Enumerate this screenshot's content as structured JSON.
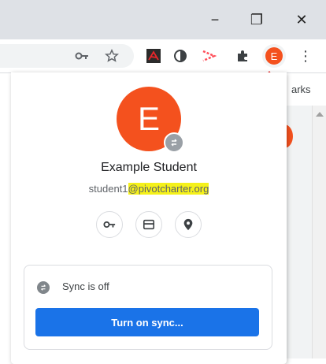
{
  "window": {
    "minimize_glyph": "−",
    "restore_glyph": "❐",
    "close_glyph": "✕"
  },
  "toolbar": {
    "icons": [
      "key-icon",
      "star-icon",
      "acrobat-icon",
      "circle-half-icon",
      "screencastify-icon",
      "extensions-icon"
    ],
    "profile_initial": "E",
    "menu_glyph": "⋮",
    "bookmarks_fragment": "arks"
  },
  "profile": {
    "avatar_initial": "E",
    "name": "Example Student",
    "email_user": "student1",
    "email_domain": "@pivotcharter.org",
    "quick_actions": [
      "key-icon",
      "card-icon",
      "location-icon"
    ]
  },
  "sync": {
    "status": "Sync is off",
    "button_label": "Turn on sync..."
  },
  "colors": {
    "avatar": "#f4511e",
    "primary_button": "#1a73e8",
    "highlight": "#f5f11a",
    "arrow": "#e8262a"
  }
}
